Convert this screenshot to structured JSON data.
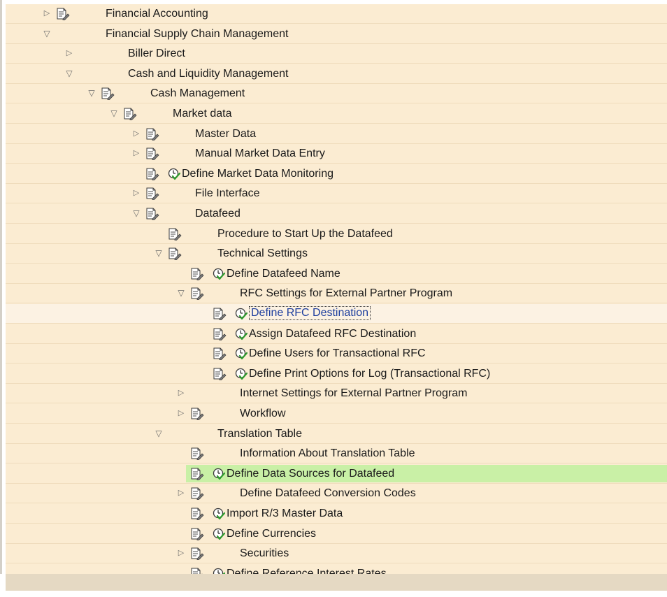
{
  "tree": {
    "nodes": [
      {
        "label": "Financial Accounting",
        "level": 0,
        "arrow": "right",
        "doc": true,
        "clock": false
      },
      {
        "label": "Financial Supply Chain Management",
        "level": 0,
        "arrow": "down",
        "doc": false,
        "clock": false
      },
      {
        "label": "Biller Direct",
        "level": 1,
        "arrow": "right",
        "doc": false,
        "clock": false
      },
      {
        "label": "Cash and Liquidity Management",
        "level": 1,
        "arrow": "down",
        "doc": false,
        "clock": false
      },
      {
        "label": "Cash Management",
        "level": 2,
        "arrow": "down",
        "doc": true,
        "clock": false
      },
      {
        "label": "Market data",
        "level": 3,
        "arrow": "down",
        "doc": true,
        "clock": false
      },
      {
        "label": "Master Data",
        "level": 4,
        "arrow": "right",
        "doc": true,
        "clock": false
      },
      {
        "label": "Manual Market Data Entry",
        "level": 4,
        "arrow": "right",
        "doc": true,
        "clock": false
      },
      {
        "label": "Define Market Data Monitoring",
        "level": 4,
        "arrow": "none",
        "doc": true,
        "clock": true
      },
      {
        "label": "File Interface",
        "level": 4,
        "arrow": "right",
        "doc": true,
        "clock": false
      },
      {
        "label": "Datafeed",
        "level": 4,
        "arrow": "down",
        "doc": true,
        "clock": false
      },
      {
        "label": "Procedure to Start Up the Datafeed",
        "level": 5,
        "arrow": "none",
        "doc": true,
        "clock": false
      },
      {
        "label": "Technical Settings",
        "level": 5,
        "arrow": "down",
        "doc": true,
        "clock": false
      },
      {
        "label": "Define Datafeed Name",
        "level": 6,
        "arrow": "none",
        "doc": true,
        "clock": true
      },
      {
        "label": "RFC Settings for External Partner Program",
        "level": 6,
        "arrow": "down",
        "doc": true,
        "clock": false
      },
      {
        "label": "Define RFC Destination",
        "level": 7,
        "arrow": "none",
        "doc": true,
        "clock": true,
        "state": "selected"
      },
      {
        "label": "Assign Datafeed RFC Destination",
        "level": 7,
        "arrow": "none",
        "doc": true,
        "clock": true
      },
      {
        "label": "Define Users for Transactional RFC",
        "level": 7,
        "arrow": "none",
        "doc": true,
        "clock": true
      },
      {
        "label": "Define Print Options for Log (Transactional RFC)",
        "level": 7,
        "arrow": "none",
        "doc": true,
        "clock": true
      },
      {
        "label": "Internet Settings for External Partner Program",
        "level": 6,
        "arrow": "right",
        "doc": false,
        "clock": false
      },
      {
        "label": "Workflow",
        "level": 6,
        "arrow": "right",
        "doc": true,
        "clock": false
      },
      {
        "label": "Translation Table",
        "level": 5,
        "arrow": "down",
        "doc": false,
        "clock": false
      },
      {
        "label": "Information About Translation Table",
        "level": 6,
        "arrow": "none",
        "doc": true,
        "clock": false
      },
      {
        "label": "Define Data Sources for Datafeed",
        "level": 6,
        "arrow": "none",
        "doc": true,
        "clock": true,
        "state": "highlighted"
      },
      {
        "label": "Define Datafeed Conversion Codes",
        "level": 6,
        "arrow": "right",
        "doc": true,
        "clock": false
      },
      {
        "label": "Import R/3 Master Data",
        "level": 6,
        "arrow": "none",
        "doc": true,
        "clock": true
      },
      {
        "label": "Define Currencies",
        "level": 6,
        "arrow": "none",
        "doc": true,
        "clock": true
      },
      {
        "label": "Securities",
        "level": 6,
        "arrow": "right",
        "doc": true,
        "clock": false
      },
      {
        "label": "Define Reference Interest Rates",
        "level": 6,
        "arrow": "none",
        "doc": true,
        "clock": true
      }
    ]
  },
  "colors": {
    "tree_bg": "#fbecd2",
    "selected_row_bg": "#fcf2e3",
    "highlight_bg": "#c9f0a6",
    "selected_text": "#1d3e9e",
    "status_bar": "#e5d9c3"
  },
  "icons": {
    "expand": "triangle-right-outline",
    "collapse": "triangle-down-outline",
    "document": "document-pencil-icon",
    "execute": "clock-checkmark-icon"
  }
}
